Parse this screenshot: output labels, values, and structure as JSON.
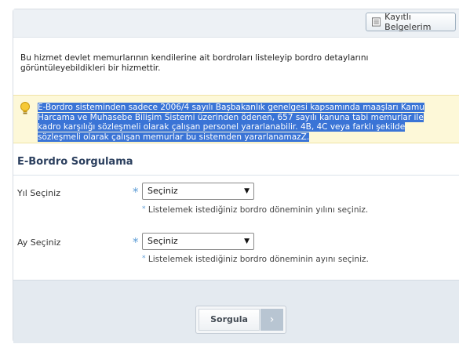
{
  "header": {
    "documents_button_label": "Kayıtlı Belgelerim"
  },
  "intro_text": "Bu hizmet devlet memurlarının kendilerine ait bordroları listeleyip bordro detaylarını görüntüleyebildikleri bir hizmettir.",
  "notice": {
    "icon": "lightbulb-icon",
    "text": "E-Bordro sisteminden sadece 2006/4 sayılı Başbakanlık genelgesi kapsamında maaşları Kamu Harcama ve Muhasebe Bilişim Sistemi üzerinden ödenen, 657 sayılı kanuna tabi memurlar ile kadro karşılığı sözleşmeli olarak çalışan personel yararlanabilir. 4B, 4C veya farklı şekilde sözleşmeli olarak çalışan memurlar bu sistemden yararlanamazZ."
  },
  "form": {
    "title": "E-Bordro Sorgulama",
    "required_mark": "*",
    "year": {
      "label": "Yıl Seçiniz",
      "selected": "Seçiniz",
      "hint": "Listelemek istediğiniz bordro döneminin yılını seçiniz."
    },
    "month": {
      "label": "Ay Seçiniz",
      "selected": "Seçiniz",
      "hint": "Listelemek istediğiniz bordro döneminin ayını seçiniz."
    },
    "submit_label": "Sorgula",
    "submit_arrow": "›"
  },
  "colors": {
    "highlight": "#3a74d6",
    "notice_bg": "#fdf8d8",
    "title": "#2b3f5e",
    "footer_bg": "#e4eaf0"
  }
}
